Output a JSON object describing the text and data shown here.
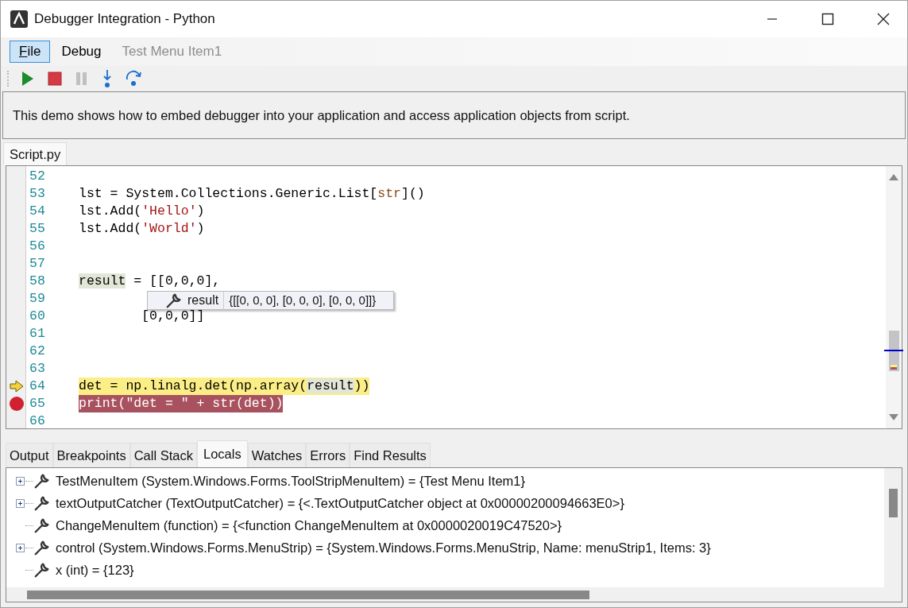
{
  "window": {
    "title": "Debugger Integration - Python"
  },
  "menu": [
    {
      "label": "File",
      "underline_first": true,
      "selected": true,
      "disabled": false
    },
    {
      "label": "Debug",
      "underline_first": false,
      "selected": false,
      "disabled": false
    },
    {
      "label": "Test Menu Item1",
      "underline_first": false,
      "selected": false,
      "disabled": true
    }
  ],
  "toolbar": [
    {
      "kind": "run",
      "disabled": false
    },
    {
      "kind": "stop",
      "disabled": false
    },
    {
      "kind": "pause",
      "disabled": true
    },
    {
      "kind": "step-into",
      "disabled": false
    },
    {
      "kind": "step-over",
      "disabled": false
    }
  ],
  "description": "This demo shows how to embed debugger into your application and access application objects from script.",
  "editor_tabs": [
    {
      "label": "Script.py",
      "selected": true
    }
  ],
  "code": [
    {
      "number": "52",
      "current": false,
      "breakpoint": false
    },
    {
      "number": "53",
      "current": false,
      "breakpoint": false,
      "tokens": [
        {
          "text": "lst = System.Collections.Generic.List[",
          "kind": "plain"
        },
        {
          "text": "str",
          "kind": "builtin"
        },
        {
          "text": "]()",
          "kind": "plain"
        }
      ]
    },
    {
      "number": "54",
      "current": false,
      "breakpoint": false,
      "tokens": [
        {
          "text": "lst.Add(",
          "kind": "plain"
        },
        {
          "text": "'Hello'",
          "kind": "string"
        },
        {
          "text": ")",
          "kind": "plain"
        }
      ]
    },
    {
      "number": "55",
      "current": false,
      "breakpoint": false,
      "tokens": [
        {
          "text": "lst.Add(",
          "kind": "plain"
        },
        {
          "text": "'World'",
          "kind": "string"
        },
        {
          "text": ")",
          "kind": "plain"
        }
      ]
    },
    {
      "number": "56",
      "current": false,
      "breakpoint": false
    },
    {
      "number": "57",
      "current": false,
      "breakpoint": false
    },
    {
      "number": "58",
      "current": false,
      "breakpoint": false,
      "tokens": [
        {
          "text": "result",
          "kind": "hover"
        },
        {
          "text": " = [[0,0,0],",
          "kind": "plain"
        }
      ]
    },
    {
      "number": "59",
      "current": false,
      "breakpoint": false
    },
    {
      "number": "60",
      "current": false,
      "breakpoint": false,
      "tokens": [
        {
          "text": "        [0,0,0]]",
          "kind": "plain"
        }
      ]
    },
    {
      "number": "61",
      "current": false,
      "breakpoint": false
    },
    {
      "number": "62",
      "current": false,
      "breakpoint": false
    },
    {
      "number": "63",
      "current": false,
      "breakpoint": false
    },
    {
      "number": "64",
      "current": true,
      "breakpoint": false,
      "tokens": [
        {
          "text": "det = np.linalg.det(np.array(",
          "kind": "plain"
        },
        {
          "text": "result",
          "kind": "hover"
        },
        {
          "text": "))",
          "kind": "plain"
        }
      ]
    },
    {
      "number": "65",
      "current": false,
      "breakpoint": true,
      "tokens": [
        {
          "text": "print(\"det = \" + str(det))",
          "kind": "plain"
        }
      ]
    },
    {
      "number": "66",
      "current": false,
      "breakpoint": false
    }
  ],
  "tooltip": {
    "name": "result",
    "value": "{[[0, 0, 0], [0, 0, 0], [0, 0, 0]]}"
  },
  "panel_tabs": [
    {
      "label": "Output",
      "selected": false
    },
    {
      "label": "Breakpoints",
      "selected": false
    },
    {
      "label": "Call Stack",
      "selected": false
    },
    {
      "label": "Locals",
      "selected": true
    },
    {
      "label": "Watches",
      "selected": false
    },
    {
      "label": "Errors",
      "selected": false
    },
    {
      "label": "Find Results",
      "selected": false
    }
  ],
  "locals": [
    {
      "text": "TestMenuItem (System.Windows.Forms.ToolStripMenuItem) = {Test Menu Item1}",
      "expandable": true
    },
    {
      "text": "textOutputCatcher (TextOutputCatcher) = {<.TextOutputCatcher object at 0x00000200094663E0>}",
      "expandable": true
    },
    {
      "text": "ChangeMenuItem (function) = {<function ChangeMenuItem at 0x0000020019C47520>}",
      "expandable": false
    },
    {
      "text": "control (System.Windows.Forms.MenuStrip) = {System.Windows.Forms.MenuStrip, Name: menuStrip1, Items: 3}",
      "expandable": true
    },
    {
      "text": "x (int) = {123}",
      "expandable": false
    }
  ]
}
